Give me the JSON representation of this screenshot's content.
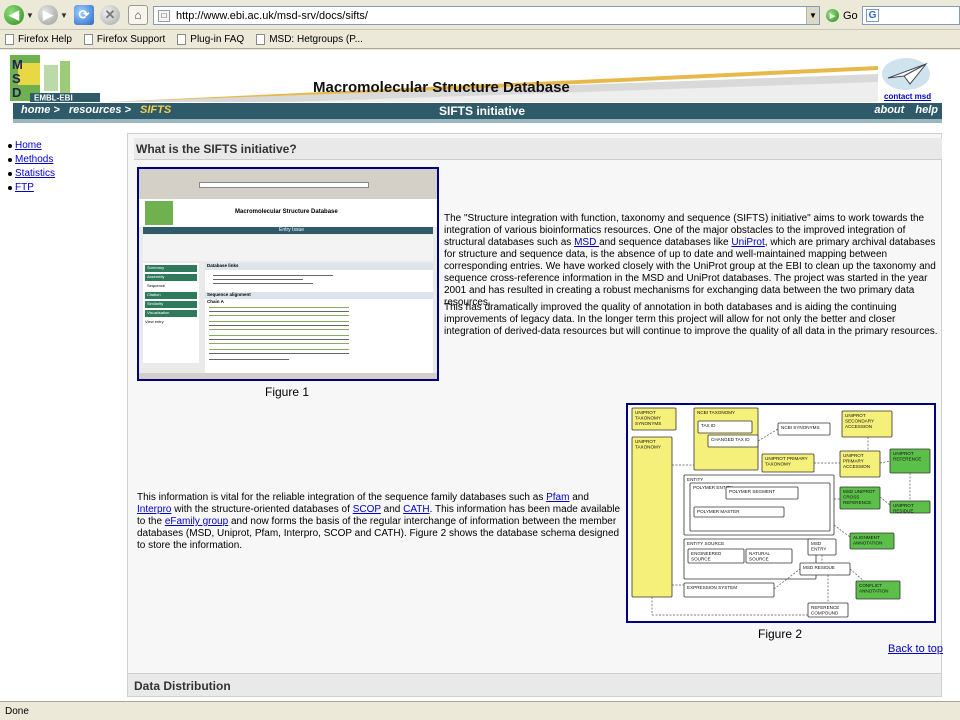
{
  "browser": {
    "url": "http://www.ebi.ac.uk/msd-srv/docs/sifts/",
    "go_label": "Go",
    "search_placeholder": "",
    "status": "Done",
    "bookmarks": [
      "Firefox Help",
      "Firefox Support",
      "Plug-in FAQ",
      "MSD: Hetgroups (P..."
    ]
  },
  "banner": {
    "title": "Macromolecular Structure Database",
    "contact_label": "contact msd"
  },
  "navbar": {
    "crumbs": [
      "home >",
      "resources >",
      "SIFTS"
    ],
    "title": "SIFTS initiative",
    "right": [
      "about",
      "help"
    ]
  },
  "sidemenu": [
    "Home",
    "Methods",
    "Statistics",
    "FTP"
  ],
  "section1": {
    "heading": "What is the SIFTS initiative?",
    "figure1_caption": "Figure 1",
    "figure2_caption": "Figure 2",
    "para1": {
      "t1": "The \"Structure integration with function, taxonomy and sequence (SIFTS) initiative\" aims to work towards the integration of various bioinformatics resources. One of the major obstacles to the improved integration of structural databases such as ",
      "l1": "MSD ",
      "t2": "and sequence databases like ",
      "l2": "UniProt",
      "t3": ", which are primary archival databases for structure and sequence data, is the absence of up to date and well-maintained mapping between corresponding entries. We have worked closely with the UniProt group at the EBI to clean up the taxonomy and sequence cross-reference information in the MSD and UniProt databases. The project was started in the year 2001 and has resulted in creating a robust mechanisms for exchanging data between the two primary data resources."
    },
    "para2": "This has dramatically improved the quality of annotation in both databases and is aiding the continuing improvements of legacy data. In the longer term this project will allow for not only the better and closer integration of derived-data resources but will continue to improve the quality of all data in the primary resources.",
    "para3": {
      "t1": "This information is vital for the reliable integration of the sequence family databases such as ",
      "l1": "Pfam",
      "t2": " and ",
      "l2": "Interpro",
      "t3": " with the structure-oriented databases of ",
      "l3": "SCOP",
      "t4": " and ",
      "l4": "CATH",
      "t5": ". This information has been made available to the ",
      "l5": "eFamily group",
      "t6": " and now forms the basis of the regular interchange of information between the member databases (MSD, Uniprot, Pfam, Interpro, SCOP and CATH). Figure 2 shows the database schema designed to store the information."
    },
    "back_to_top": "Back to top"
  },
  "section2": {
    "heading": "Data Distribution"
  },
  "figure1_screenshot": {
    "banner_title": "Macromolecular Structure Database",
    "entry_label": "Entry Issue",
    "side_items": [
      "Summary",
      "Assembly",
      "Sequence",
      "Citation",
      "Similarity",
      "Visualisation"
    ],
    "view_entry_label": "View entry",
    "db_links_heading": "Database links",
    "seq_align_heading": "Sequence alignment",
    "chain_label": "Chain A"
  },
  "figure2_schema": {
    "boxes": [
      "UNIPROT TAXONOMY SYNONYMS",
      "UNIPROT TAXONOMY",
      "NCBI TAXONOMY",
      "TAX ID",
      "CHANGED TAX ID",
      "NCBI SYNONYMS",
      "UNIPROT SECONDARY ACCESSION",
      "UNIPROT PRIMARY TAXONOMY",
      "UNIPROT PRIMARY ACCESSION",
      "UNIPROT REFERENCE",
      "ENTITY",
      "POLYMER ENTITY",
      "POLYMER SEGMENT",
      "POLYMER MASTER",
      "MSD UNIPROT CROSS REFERENCE",
      "UNIPROT RESIDUE",
      "ENTITY SOURCE",
      "ENGINEERED SOURCE",
      "NATURAL SOURCE",
      "MSD ENTRY",
      "ALIGNMENT ANNOTATION",
      "MSD RESIDUE",
      "EXPRESSION SYSTEM",
      "CONFLICT ANNOTATION",
      "REFERENCE COMPOUND"
    ]
  },
  "colors": {
    "navbar": "#2e5a6a",
    "crumb_current": "#f3d04a",
    "link": "#0000cc",
    "figure_border": "#000080",
    "schema_yellow": "#f5f07a",
    "schema_green": "#5cbf4a"
  }
}
